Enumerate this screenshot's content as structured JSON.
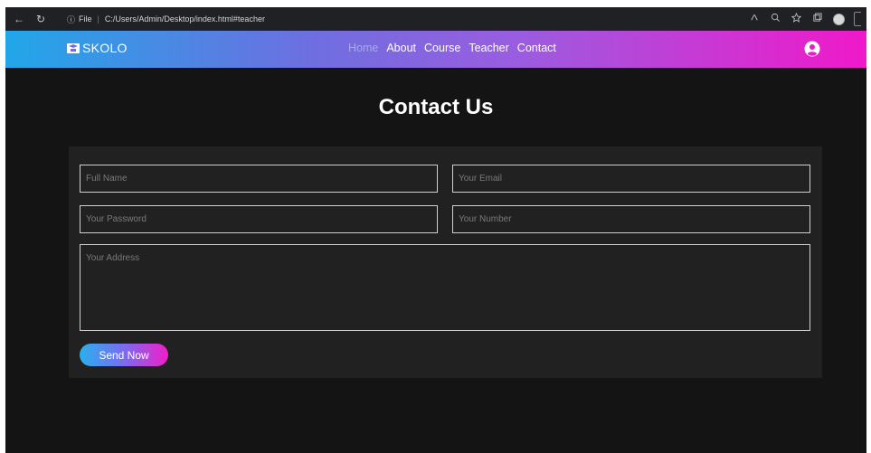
{
  "browser": {
    "back_icon": "←",
    "refresh_icon": "↻",
    "info_icon": "ⓘ",
    "file_label": "File",
    "separator": "|",
    "url": "C:/Users/Admin/Desktop/index.html#teacher"
  },
  "brand": {
    "name": "SKOLO"
  },
  "nav": {
    "items": [
      {
        "label": "Home"
      },
      {
        "label": "About"
      },
      {
        "label": "Course"
      },
      {
        "label": "Teacher"
      },
      {
        "label": "Contact"
      }
    ]
  },
  "contact": {
    "title": "Contact Us",
    "full_name_placeholder": "Full Name",
    "email_placeholder": "Your Email",
    "password_placeholder": "Your Password",
    "number_placeholder": "Your Number",
    "address_placeholder": "Your Address",
    "send_label": "Send Now"
  },
  "colors": {
    "gradient_start": "#21a7e9",
    "gradient_end": "#f019c9",
    "background": "#141414",
    "card": "#212121"
  }
}
